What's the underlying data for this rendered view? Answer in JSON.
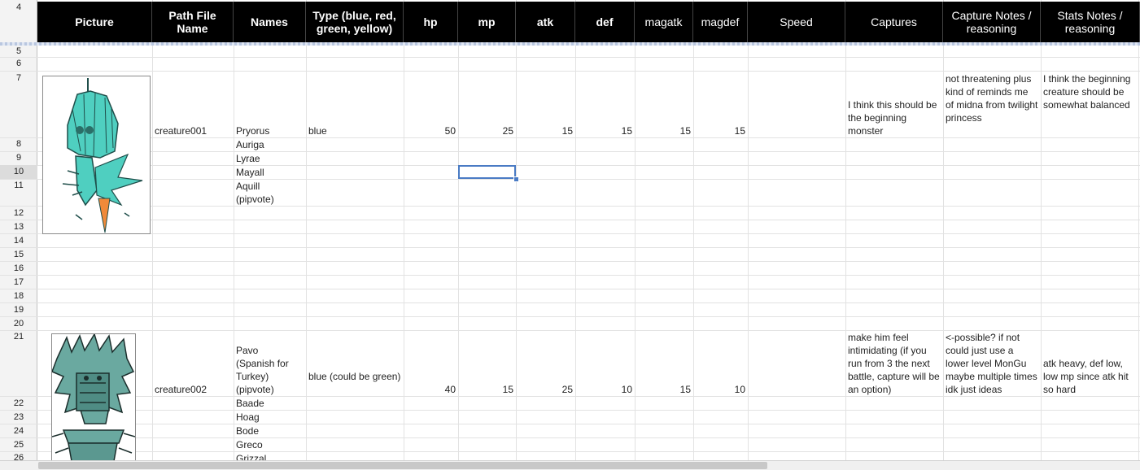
{
  "headers": {
    "rownum": "4",
    "picture": "Picture",
    "path": "Path File Name",
    "names": "Names",
    "type": "Type (blue, red, green, yellow)",
    "hp": "hp",
    "mp": "mp",
    "atk": "atk",
    "def": "def",
    "magatk": "magatk",
    "magdef": "magdef",
    "speed": "Speed",
    "captures": "Captures",
    "capture_notes": "Capture Notes / reasoning",
    "stats_notes": "Stats Notes / reasoning"
  },
  "row_numbers": [
    "5",
    "6",
    "7",
    "8",
    "9",
    "10",
    "11",
    "12",
    "13",
    "14",
    "15",
    "16",
    "17",
    "18",
    "19",
    "20",
    "21",
    "22",
    "23",
    "24",
    "25",
    "26"
  ],
  "selected_row": "10",
  "creature1": {
    "path": "creature001",
    "names": [
      "Pryorus",
      "Auriga",
      "Lyrae",
      "Mayall",
      "Aquill\n(pipvote)"
    ],
    "type": "blue",
    "hp": "50",
    "mp": "25",
    "atk": "15",
    "def": "15",
    "magatk": "15",
    "magdef": "15",
    "captures": "I think this should be the beginning monster",
    "capture_notes": "not threatening plus kind of reminds me of midna from twilight princess",
    "stats_notes": "I think the beginning creature should be somewhat balanced",
    "colors": {
      "body": "#4fcfc0",
      "outline": "#1f4e4a",
      "accent": "#f08a3a"
    }
  },
  "creature2": {
    "path": "creature002",
    "names": [
      "Pavo\n(Spanish for\nTurkey)\n(pipvote)",
      "Baade",
      "Hoag",
      "Bode",
      "Greco",
      "Grizzal"
    ],
    "type": "blue (could be green)",
    "hp": "40",
    "mp": "15",
    "atk": "25",
    "def": "10",
    "magatk": "15",
    "magdef": "10",
    "captures": "make him feel intimidating (if you run from 3 the next battle, capture will be an option)",
    "capture_notes": "<-possible? if not could just use a lower level MonGu maybe multiple times idk just ideas",
    "stats_notes": "atk heavy, def low, low mp since atk hit so hard",
    "colors": {
      "body": "#6aa9a0",
      "outline": "#1b2e2c"
    }
  }
}
